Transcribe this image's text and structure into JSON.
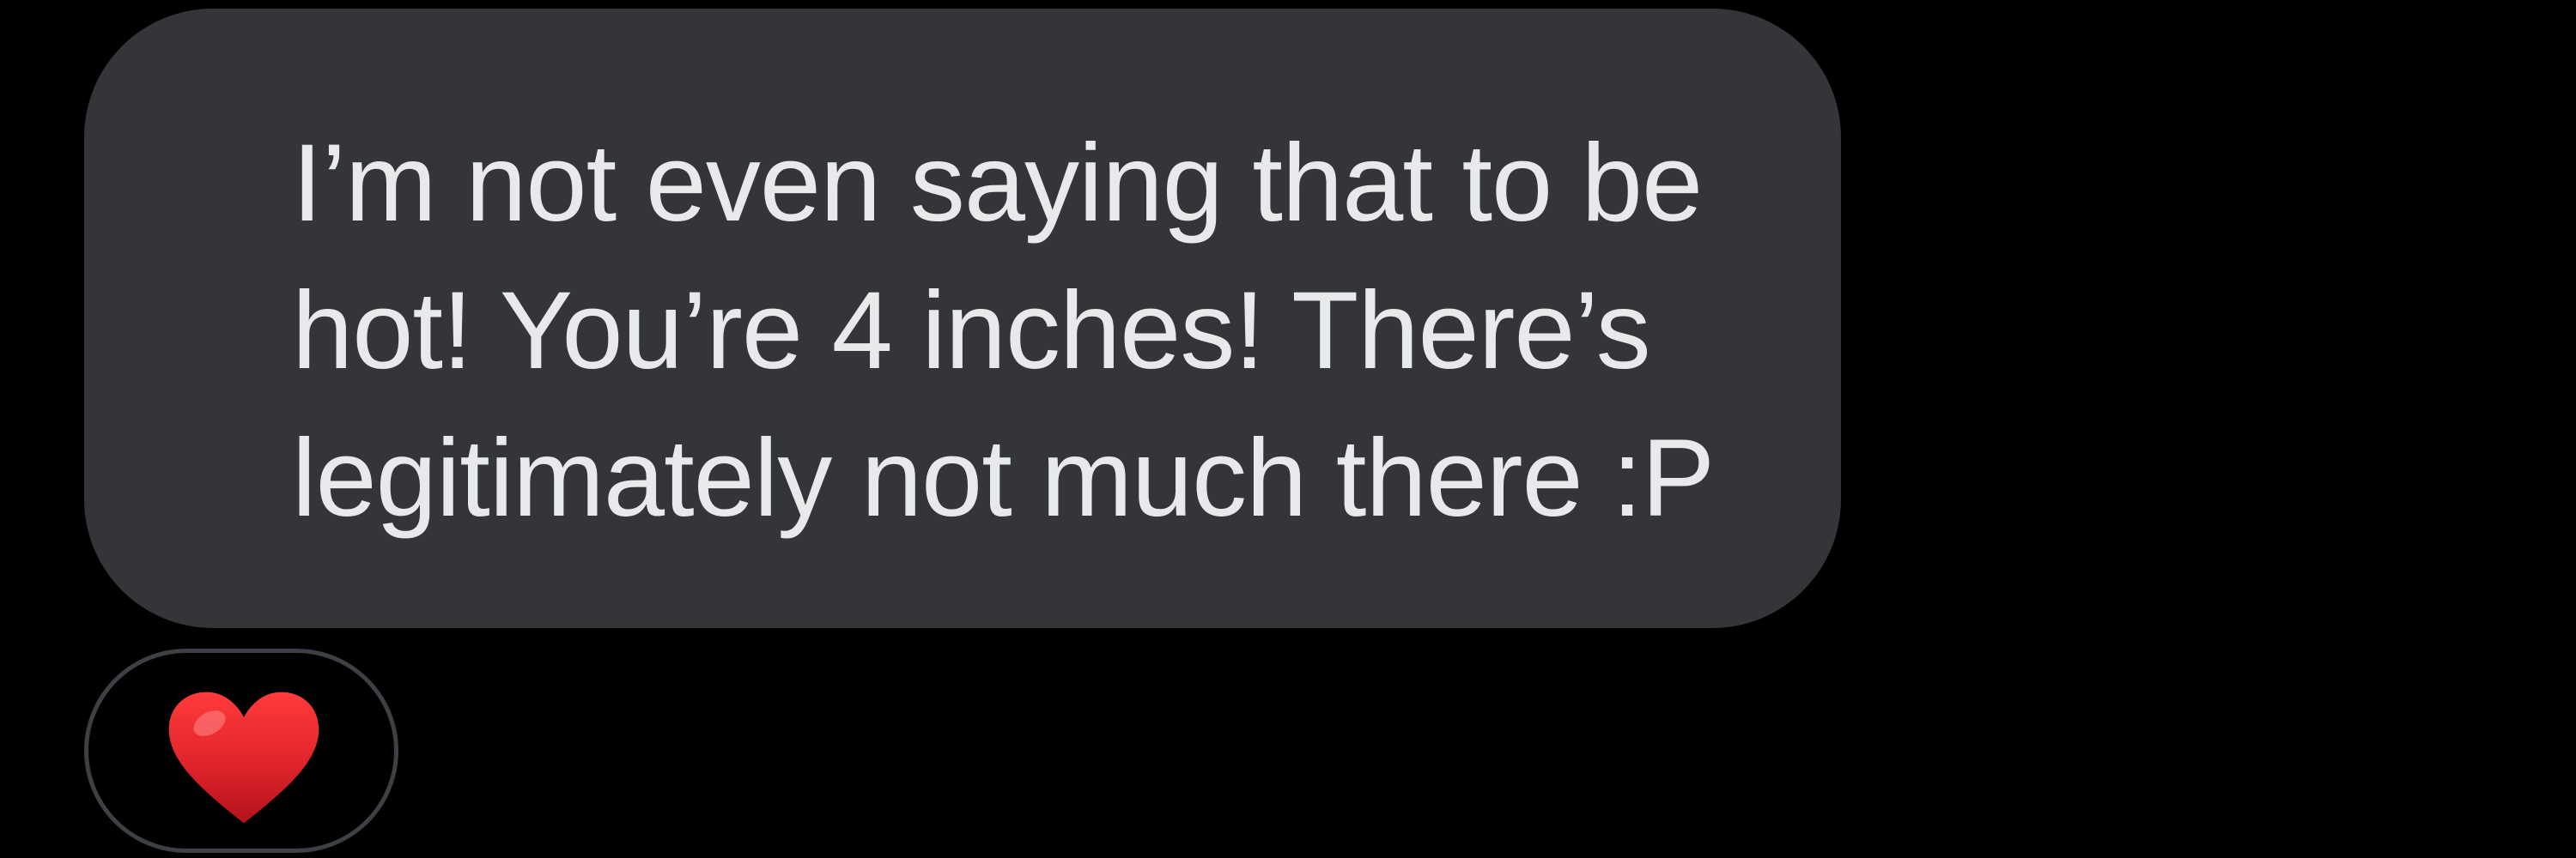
{
  "message": {
    "lines": [
      "I’m not even saying that to be",
      "hot! You’re 4 inches! There’s",
      "legitimately not much there :P"
    ]
  },
  "reaction": {
    "icon": "red-heart-icon",
    "emoji": "❤️"
  },
  "colors": {
    "background": "#000000",
    "bubble": "#333538",
    "text": "#e7e9ea",
    "reaction_border": "#3d4044",
    "heart": "#e0242c"
  }
}
